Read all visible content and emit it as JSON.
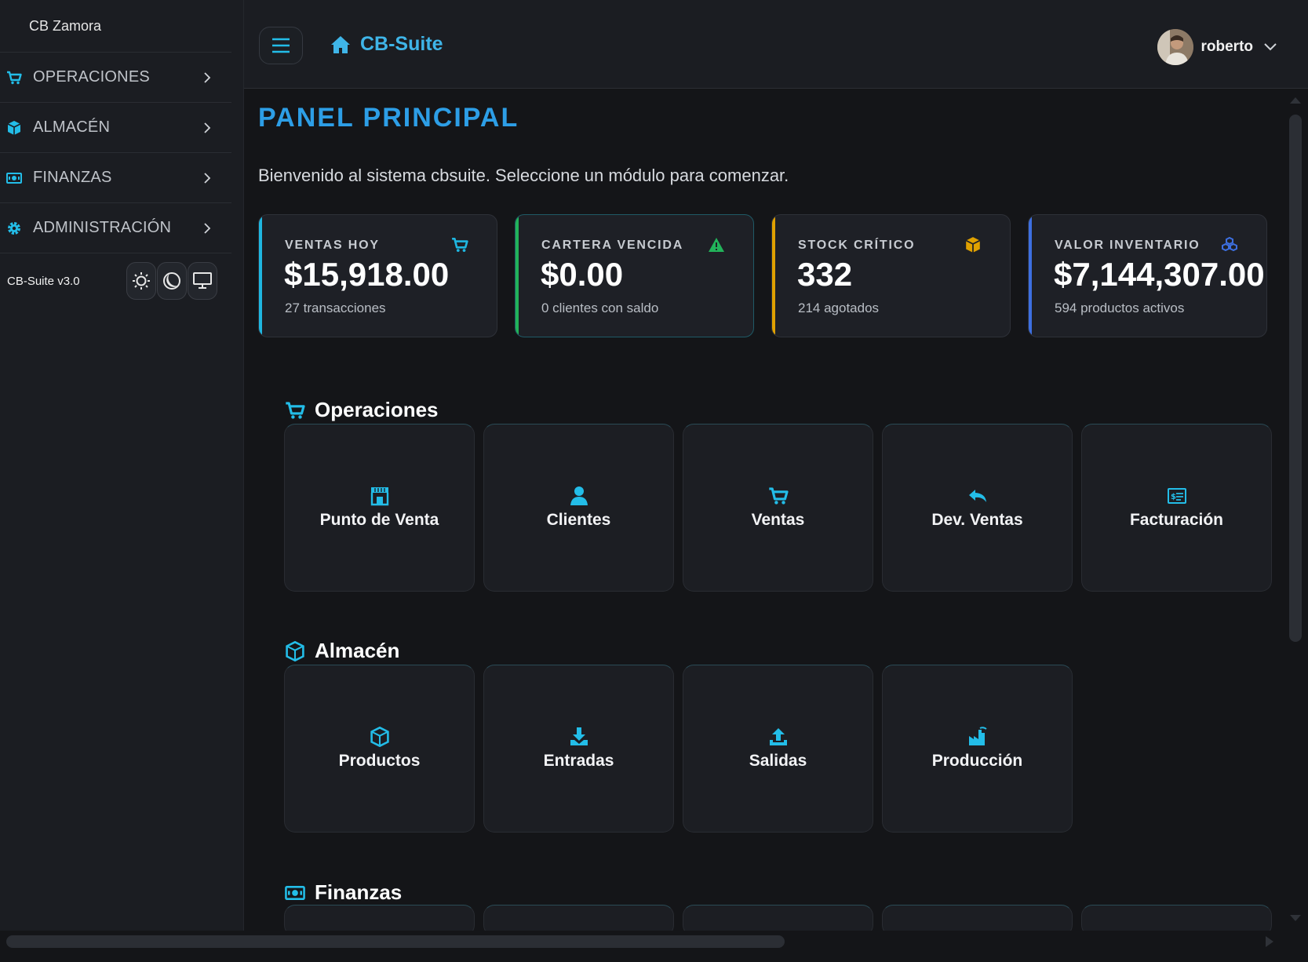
{
  "sidebar": {
    "company": "CB Zamora",
    "items": [
      {
        "label": "OPERACIONES",
        "icon": "cart-icon"
      },
      {
        "label": "ALMACÉN",
        "icon": "box-icon"
      },
      {
        "label": "FINANZAS",
        "icon": "money-icon"
      },
      {
        "label": "ADMINISTRACIÓN",
        "icon": "gear-icon"
      }
    ],
    "version": "CB-Suite v3.0",
    "theme_buttons": [
      "sun-icon",
      "moon-icon",
      "monitor-icon"
    ]
  },
  "header": {
    "brand": "CB-Suite",
    "user_name": "roberto"
  },
  "main": {
    "title": "PANEL PRINCIPAL",
    "welcome": "Bienvenido al sistema cbsuite. Seleccione un módulo para comenzar.",
    "stats": [
      {
        "label": "VENTAS HOY",
        "value": "$15,918.00",
        "sub": "27 transacciones",
        "color": "#1fb6e0",
        "icon": "cart-icon"
      },
      {
        "label": "CARTERA VENCIDA",
        "value": "$0.00",
        "sub": "0 clientes con saldo",
        "color": "#22b35a",
        "icon": "warning-icon"
      },
      {
        "label": "STOCK CRÍTICO",
        "value": "332",
        "sub": "214 agotados",
        "color": "#e0a100",
        "icon": "box-icon"
      },
      {
        "label": "VALOR INVENTARIO",
        "value": "$7,144,307.00",
        "sub": "594 productos activos",
        "color": "#3d6fe0",
        "icon": "cubes-icon"
      }
    ],
    "sections": [
      {
        "title": "Operaciones",
        "icon": "cart-icon",
        "tiles": [
          "Punto de Venta",
          "Clientes",
          "Ventas",
          "Dev. Ventas",
          "Facturación"
        ]
      },
      {
        "title": "Almacén",
        "icon": "box-icon",
        "tiles": [
          "Productos",
          "Entradas",
          "Salidas",
          "Producción"
        ]
      },
      {
        "title": "Finanzas",
        "icon": "money-icon"
      }
    ]
  },
  "colors": {
    "accent": "#23bde8",
    "title_blue": "#2d9ee6",
    "background": "#141518",
    "panel": "#1b1d22"
  }
}
